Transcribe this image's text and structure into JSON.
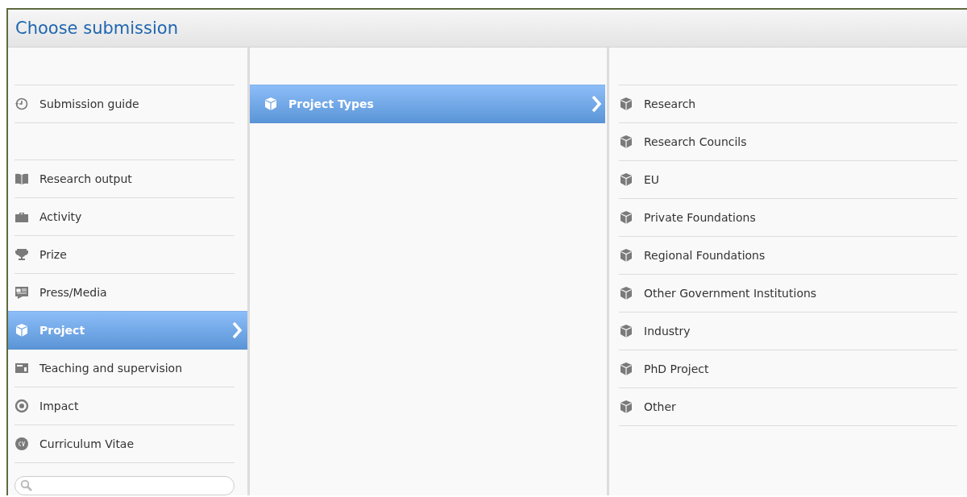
{
  "window": {
    "title": "Choose submission"
  },
  "sidebar": {
    "sections": [
      {
        "items": [
          {
            "label": "Submission guide",
            "kind": "clock",
            "selected": false
          }
        ]
      },
      {
        "items": [
          {
            "label": "Research output",
            "kind": "book",
            "selected": false
          },
          {
            "label": "Activity",
            "kind": "briefcase",
            "selected": false
          },
          {
            "label": "Prize",
            "kind": "trophy",
            "selected": false
          },
          {
            "label": "Press/Media",
            "kind": "news",
            "selected": false
          },
          {
            "label": "Project",
            "kind": "cube",
            "selected": true
          },
          {
            "label": "Teaching and supervision",
            "kind": "board",
            "selected": false
          },
          {
            "label": "Impact",
            "kind": "target",
            "selected": false
          },
          {
            "label": "Curriculum Vitae",
            "kind": "cv",
            "selected": false
          }
        ]
      }
    ]
  },
  "middle": {
    "items": [
      {
        "label": "Project Types",
        "selected": true
      }
    ]
  },
  "right": {
    "items": [
      {
        "label": "Research"
      },
      {
        "label": "Research Councils"
      },
      {
        "label": "EU"
      },
      {
        "label": "Private Foundations"
      },
      {
        "label": "Regional Foundations"
      },
      {
        "label": "Other Government Institutions"
      },
      {
        "label": "Industry"
      },
      {
        "label": "PhD Project"
      },
      {
        "label": "Other"
      }
    ]
  }
}
